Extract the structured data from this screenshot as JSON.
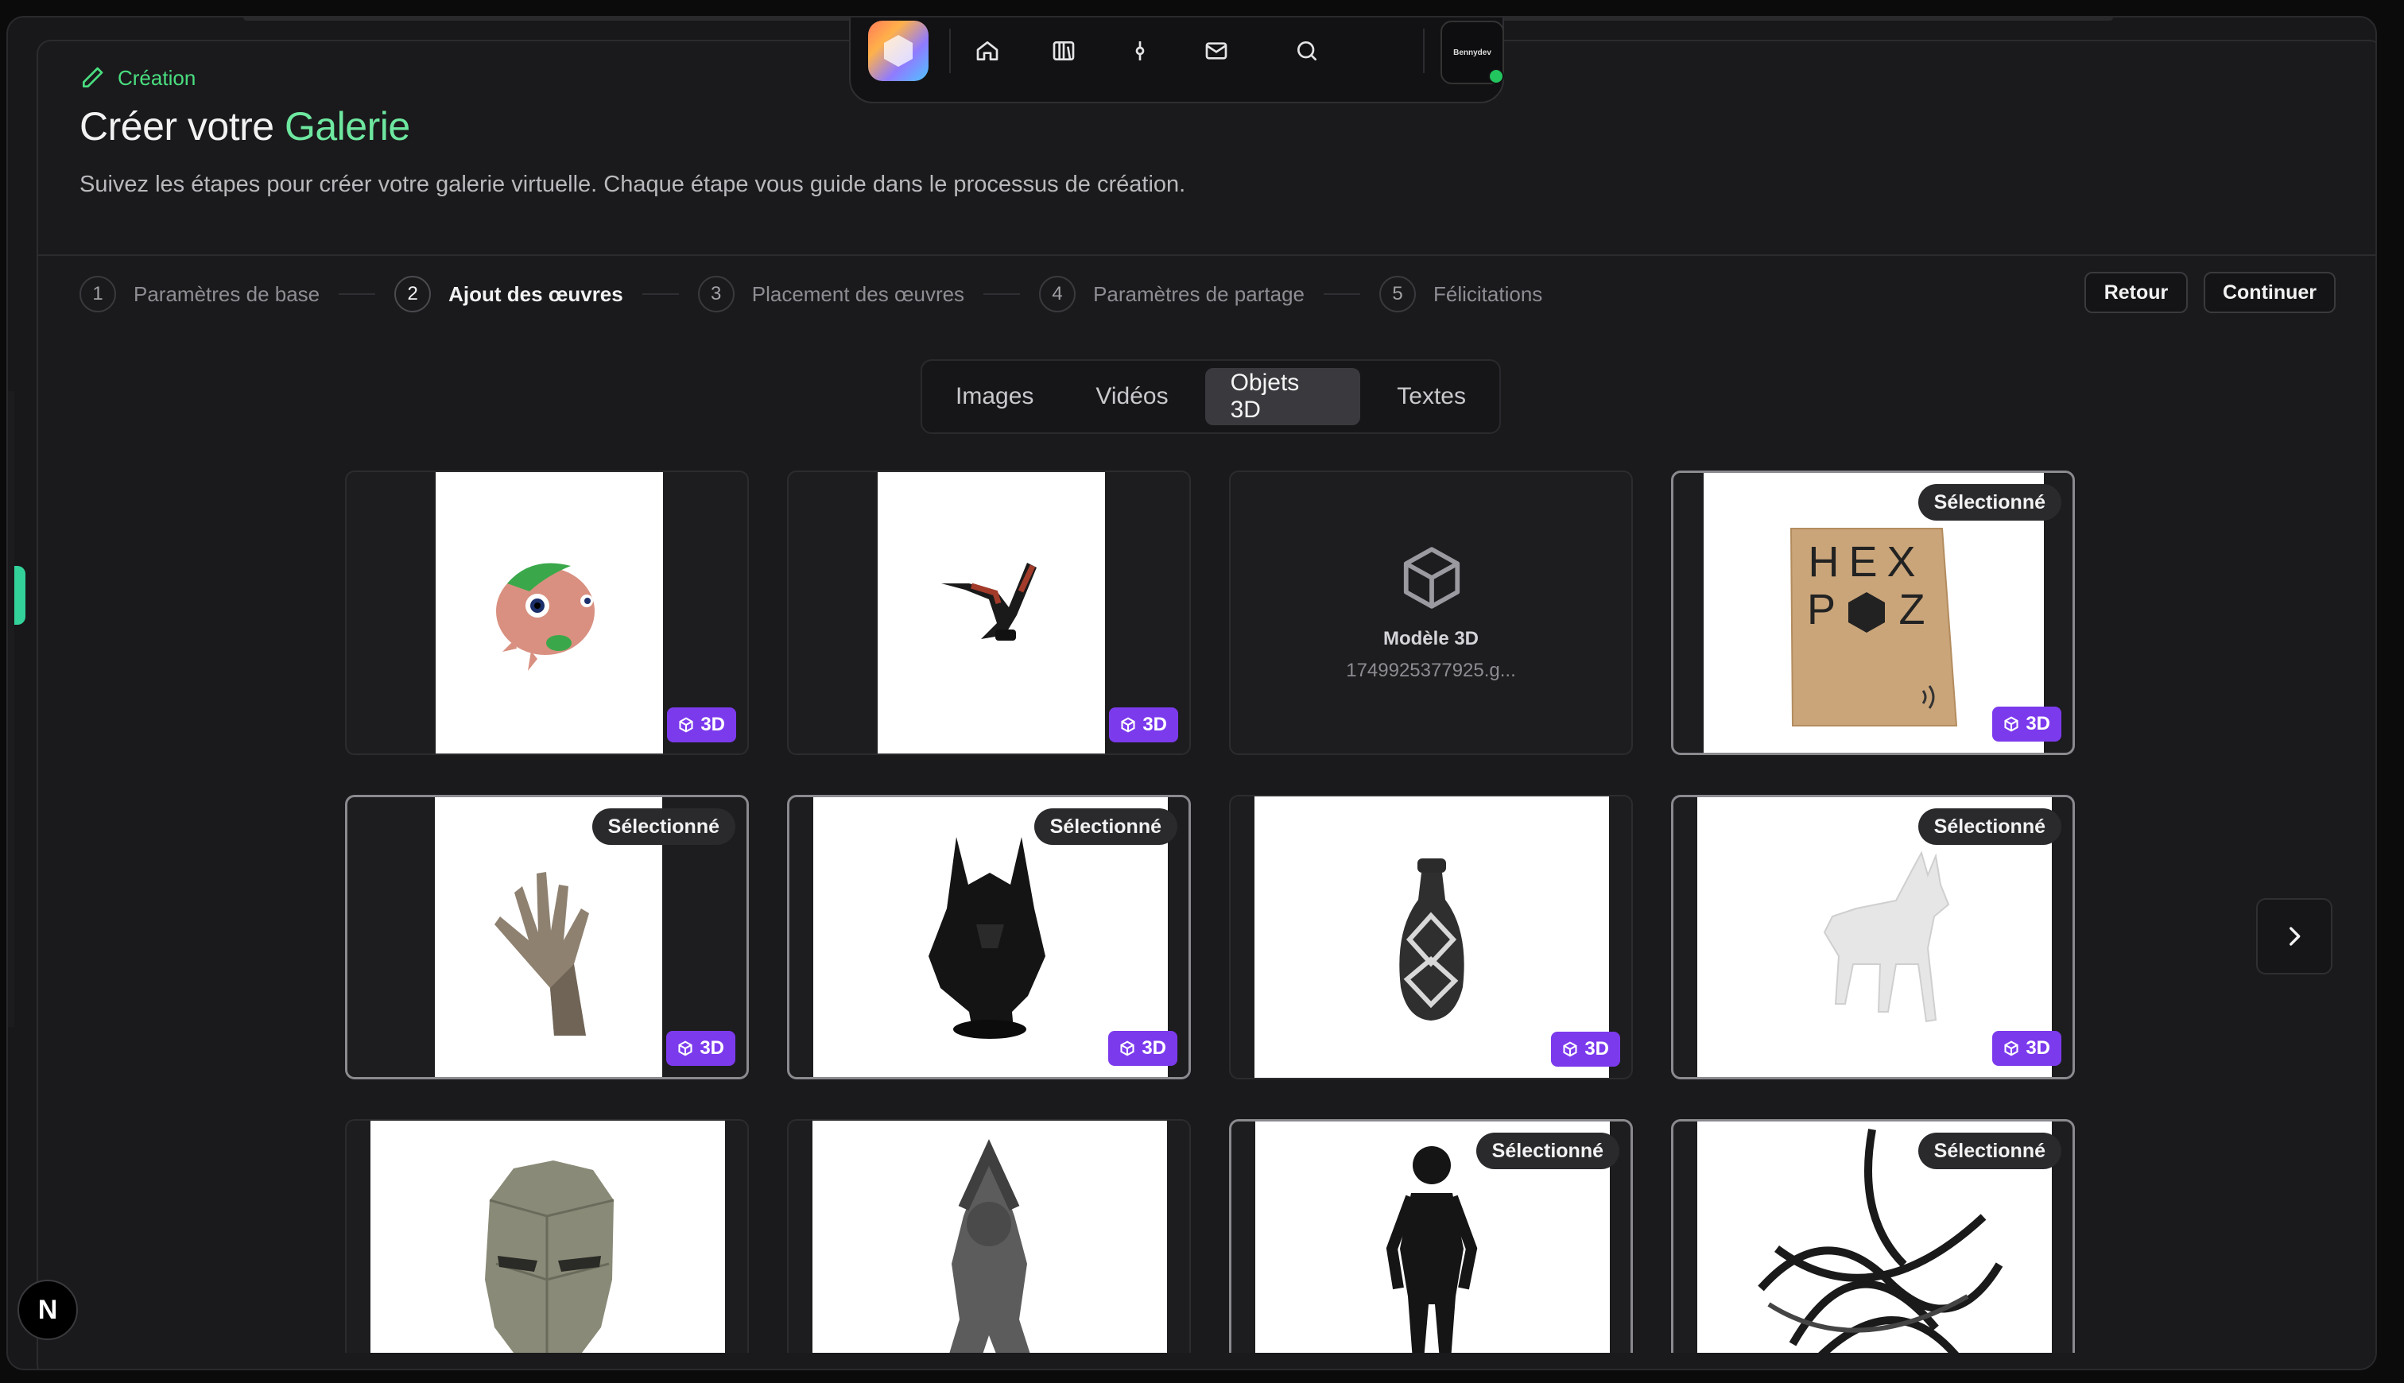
{
  "header": {
    "breadcrumb": "Création",
    "title_prefix": "Créer votre ",
    "title_accent": "Galerie",
    "description": "Suivez les étapes pour créer votre galerie virtuelle. Chaque étape vous guide dans le processus de création."
  },
  "nav": {
    "avatar_label": "Bennydev",
    "icons": [
      "home-icon",
      "library-icon",
      "commit-icon",
      "mail-icon",
      "search-icon"
    ]
  },
  "steps": [
    {
      "num": "1",
      "label": "Paramètres de base"
    },
    {
      "num": "2",
      "label": "Ajout des œuvres",
      "active": true
    },
    {
      "num": "3",
      "label": "Placement des œuvres"
    },
    {
      "num": "4",
      "label": "Paramètres de partage"
    },
    {
      "num": "5",
      "label": "Félicitations"
    }
  ],
  "actions": {
    "back": "Retour",
    "continue": "Continuer"
  },
  "tabs": [
    "Images",
    "Vidéos",
    "Objets 3D",
    "Textes"
  ],
  "active_tab": "Objets 3D",
  "labels": {
    "badge_3d": "3D",
    "selected": "Sélectionné"
  },
  "placeholder": {
    "title": "Modèle 3D",
    "file": "1749925377925.g..."
  },
  "items": [
    {
      "subject": "pink creature figure",
      "selected": false
    },
    {
      "subject": "robotic arm",
      "selected": false
    },
    {
      "subject": "placeholder",
      "selected": false
    },
    {
      "subject": "HEX POZ wooden sign",
      "selected": true
    },
    {
      "subject": "stone hand",
      "selected": true
    },
    {
      "subject": "dark helmet bust",
      "selected": true
    },
    {
      "subject": "patterned vase",
      "selected": false
    },
    {
      "subject": "white dog statue",
      "selected": true
    },
    {
      "subject": "low poly mask",
      "selected": false
    },
    {
      "subject": "gorilla statue",
      "selected": false
    },
    {
      "subject": "wireframe figure",
      "selected": true
    },
    {
      "subject": "tangled sculpture",
      "selected": true
    }
  ],
  "hexpoz": {
    "line1": "HEX",
    "line2_left": "P",
    "line2_right": "Z"
  },
  "next_logo": "N",
  "colors": {
    "accent_green": "#4ade80",
    "badge_purple": "#7c3aed",
    "background": "#1a1a1c"
  }
}
